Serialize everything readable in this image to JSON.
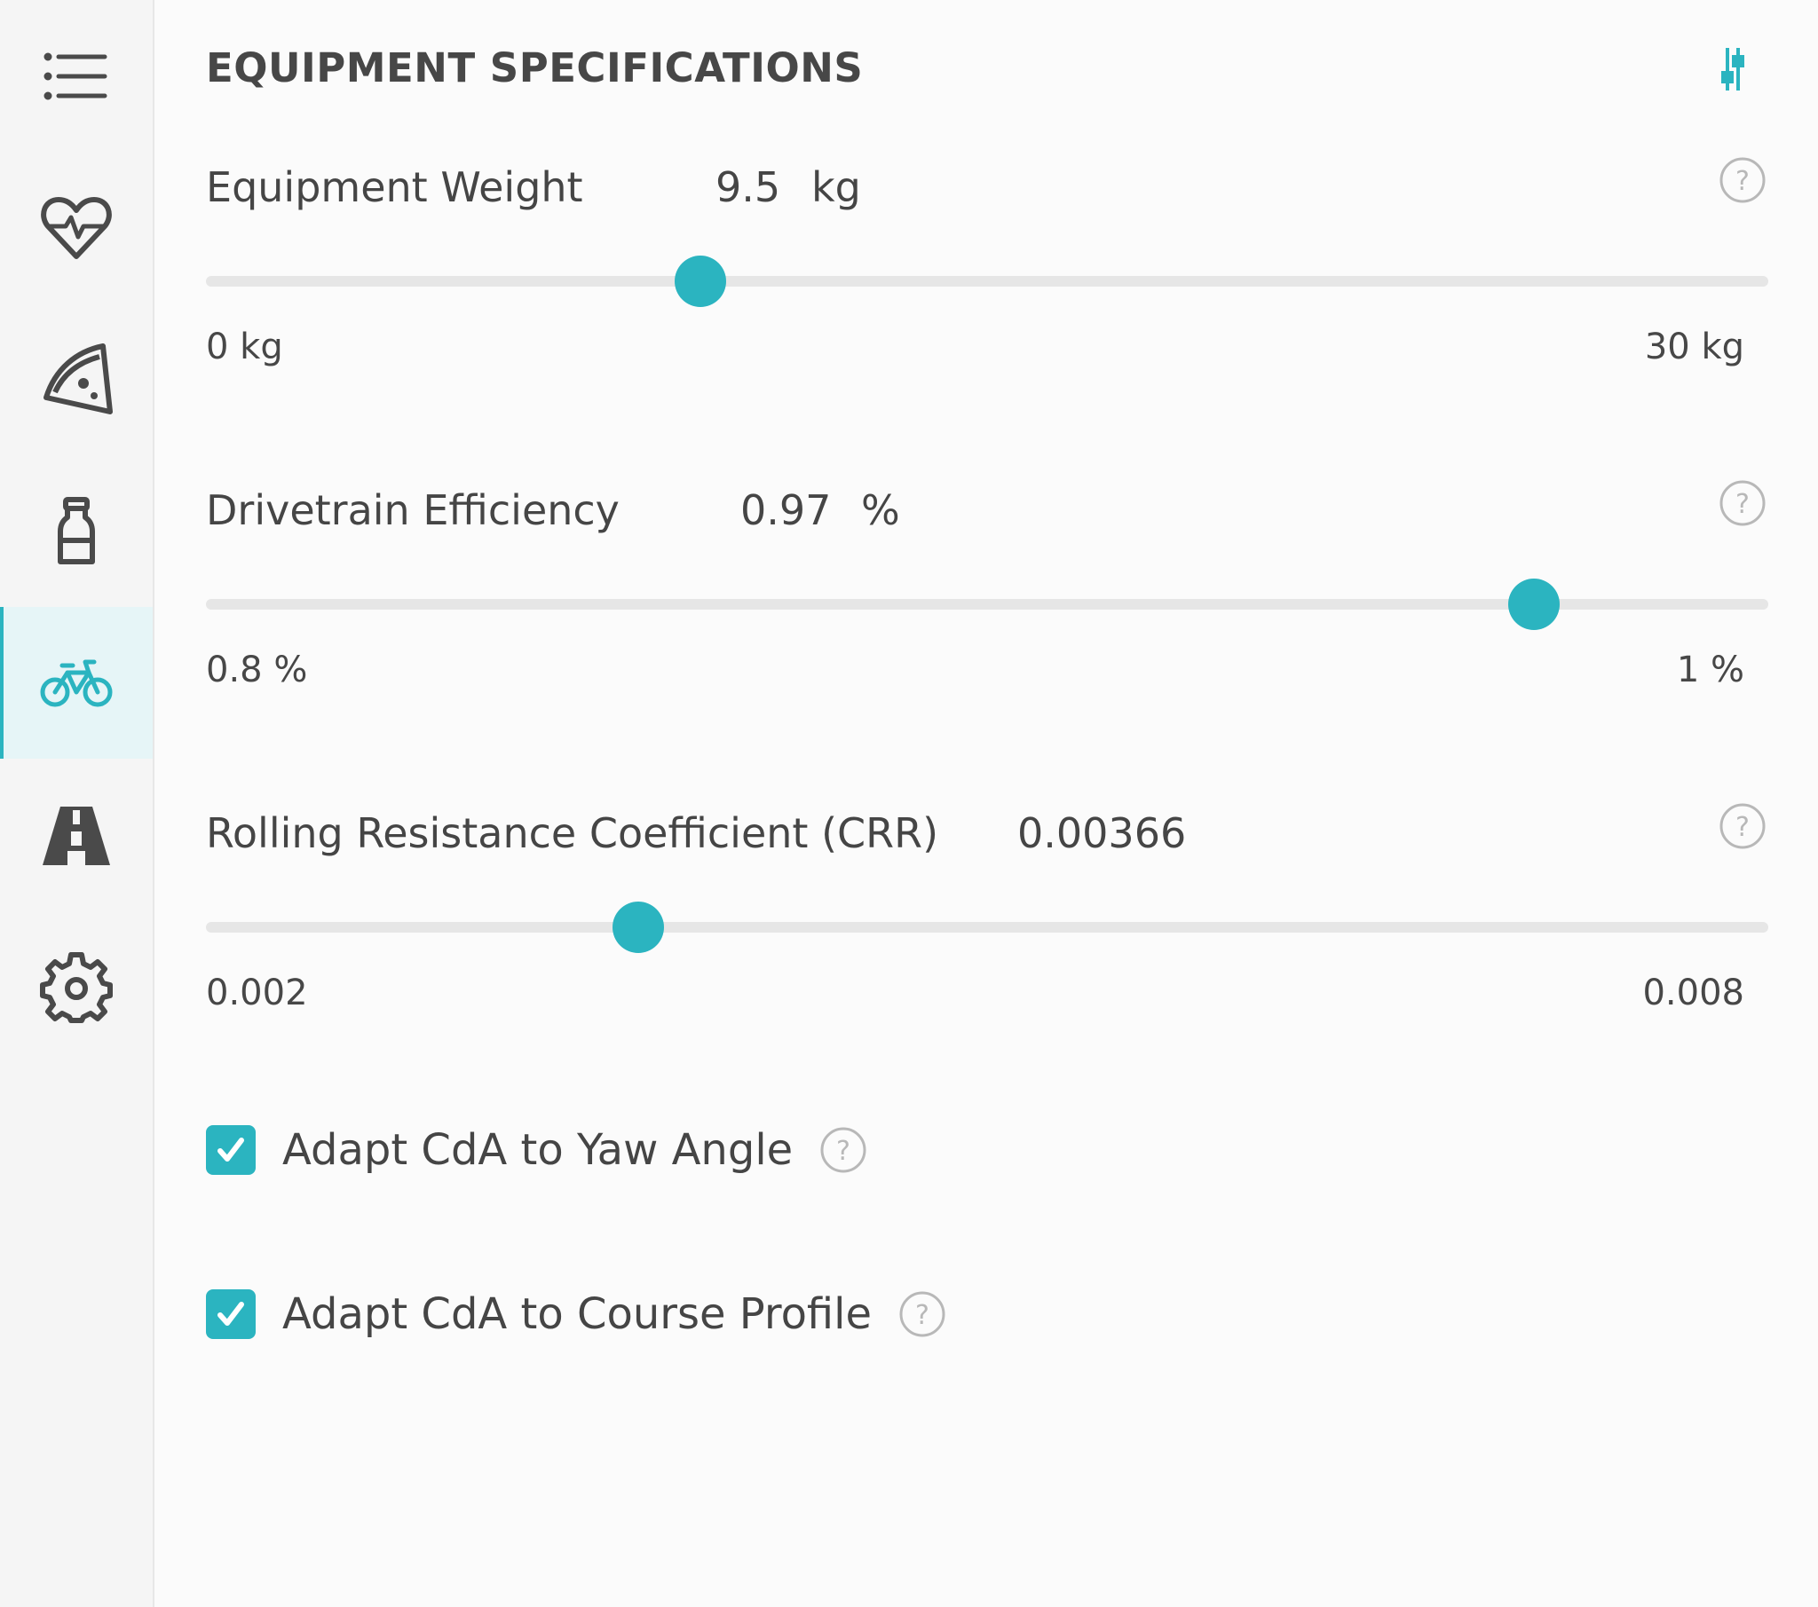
{
  "sidebar": {
    "items": [
      {
        "name": "menu",
        "icon": "menu-list-icon",
        "active": false
      },
      {
        "name": "heart-rate",
        "icon": "heart-pulse-icon",
        "active": false
      },
      {
        "name": "nutrition",
        "icon": "pizza-slice-icon",
        "active": false
      },
      {
        "name": "hydration",
        "icon": "bottle-icon",
        "active": false
      },
      {
        "name": "equipment",
        "icon": "bicycle-icon",
        "active": true
      },
      {
        "name": "course",
        "icon": "road-icon",
        "active": false
      },
      {
        "name": "settings",
        "icon": "gear-icon",
        "active": false
      }
    ]
  },
  "main": {
    "title": "EQUIPMENT SPECIFICATIONS",
    "filters_icon": "sliders-icon"
  },
  "fields": {
    "equipment_weight": {
      "label": "Equipment Weight",
      "value": "9.5",
      "unit": "kg",
      "min_label": "0 kg",
      "max_label": "30 kg",
      "level": 0.3167
    },
    "drivetrain_efficiency": {
      "label": "Drivetrain Efficiency",
      "value": "0.97",
      "unit": "%",
      "min_label": "0.8 %",
      "max_label": "1 %",
      "level": 0.85
    },
    "crr": {
      "label": "Rolling Resistance Coefficient (CRR)",
      "value": "0.00366",
      "unit": "",
      "min_label": "0.002",
      "max_label": "0.008",
      "level": 0.2767
    }
  },
  "checkboxes": {
    "yaw": {
      "label": "Adapt CdA to Yaw Angle",
      "checked": true
    },
    "profile": {
      "label": "Adapt CdA to Course Profile",
      "checked": true
    }
  },
  "colors": {
    "accent": "#2bb4c0",
    "icon_gray": "#4a4a4a",
    "help_gray": "#b8b8b8",
    "track": "#e6e6e6"
  }
}
